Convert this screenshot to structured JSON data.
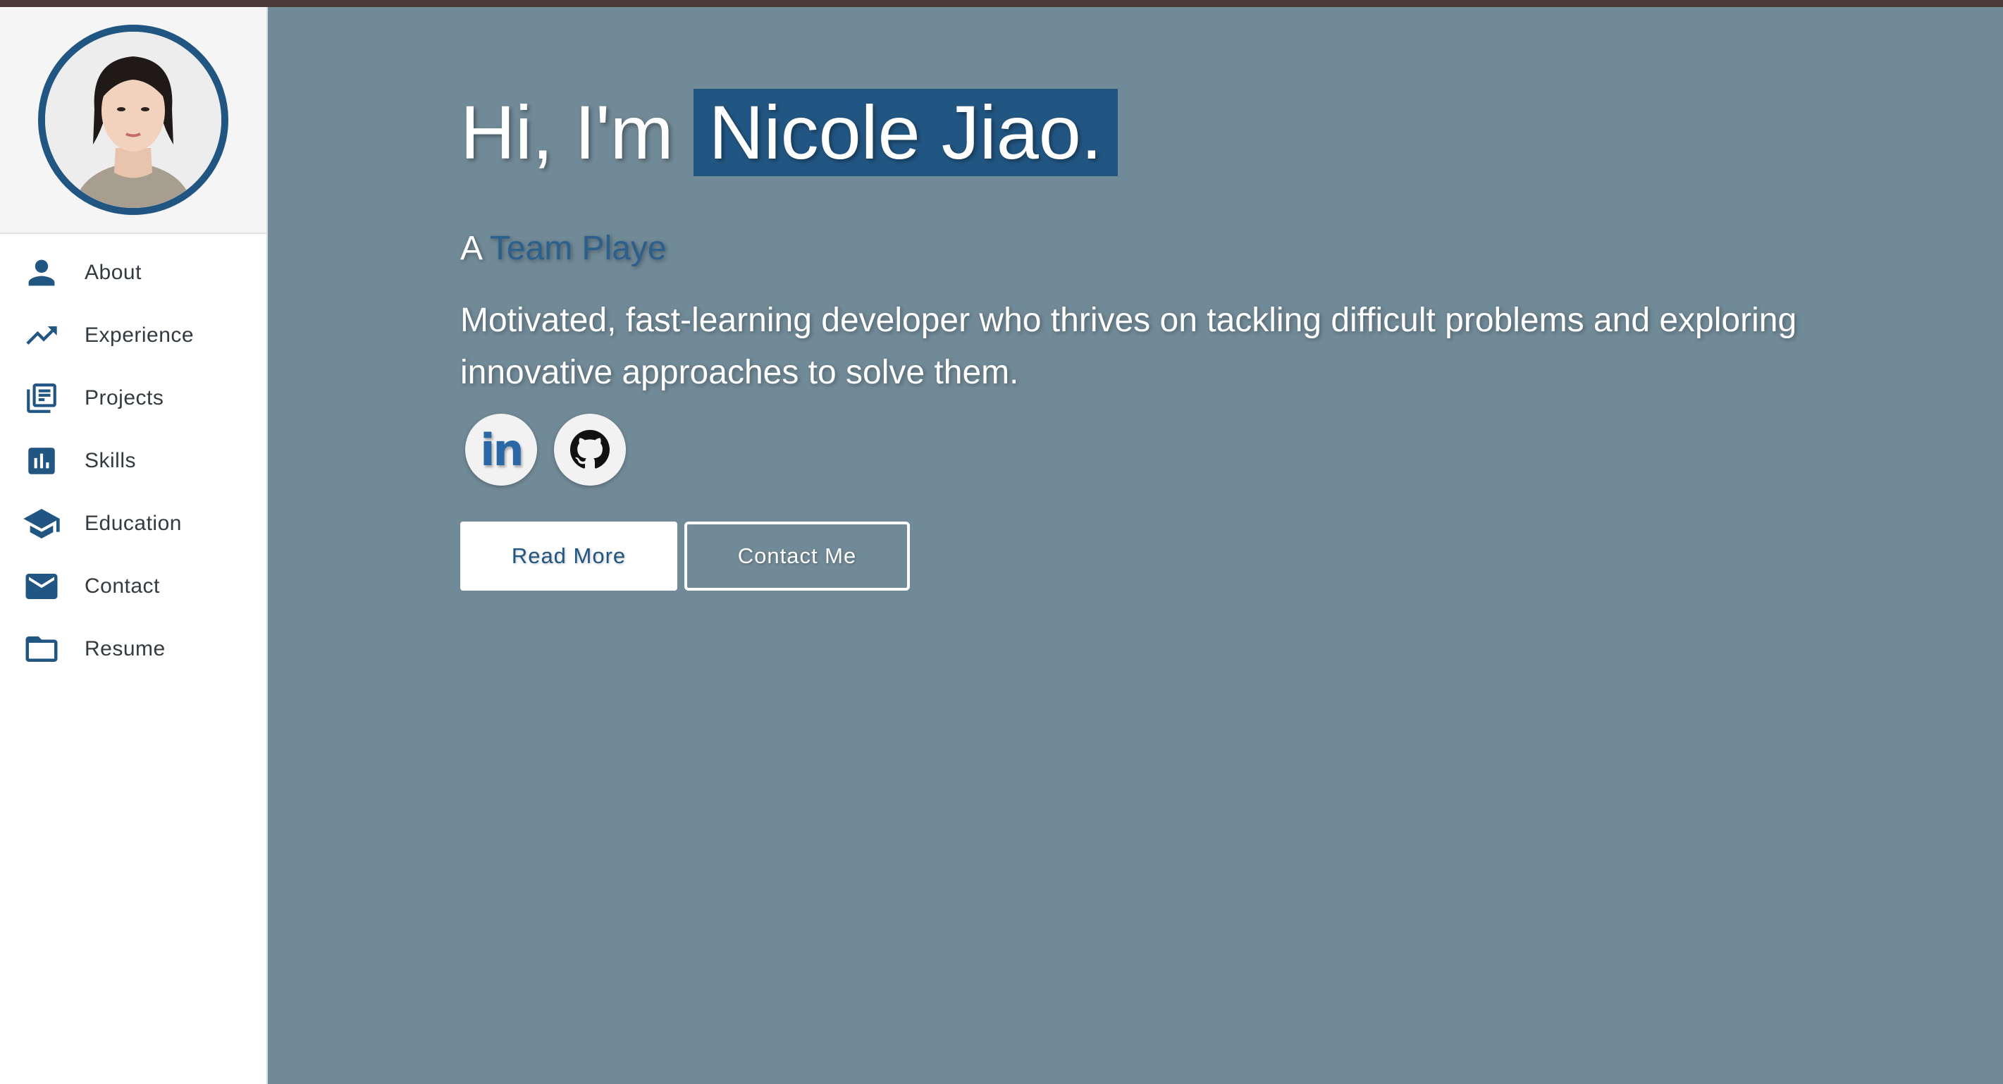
{
  "sidebar": {
    "items": [
      {
        "label": "About",
        "icon": "person-icon"
      },
      {
        "label": "Experience",
        "icon": "trending-up-icon"
      },
      {
        "label": "Projects",
        "icon": "library-books-icon"
      },
      {
        "label": "Skills",
        "icon": "bar-chart-icon"
      },
      {
        "label": "Education",
        "icon": "graduation-cap-icon"
      },
      {
        "label": "Contact",
        "icon": "mail-icon"
      },
      {
        "label": "Resume",
        "icon": "folder-icon"
      }
    ]
  },
  "hero": {
    "greeting": "Hi, I'm",
    "name": "Nicole Jiao.",
    "subtitle_prefix": "A",
    "subtitle_role": "Team Playe",
    "intro": "Motivated, fast-learning developer who thrives on tackling difficult problems and exploring innovative approaches to solve them."
  },
  "social": {
    "linkedin_label": "in"
  },
  "actions": {
    "read_more": "Read More",
    "contact_me": "Contact Me"
  },
  "colors": {
    "accent": "#225682",
    "background": "#718a97",
    "sidebar_bg": "#ffffff"
  }
}
